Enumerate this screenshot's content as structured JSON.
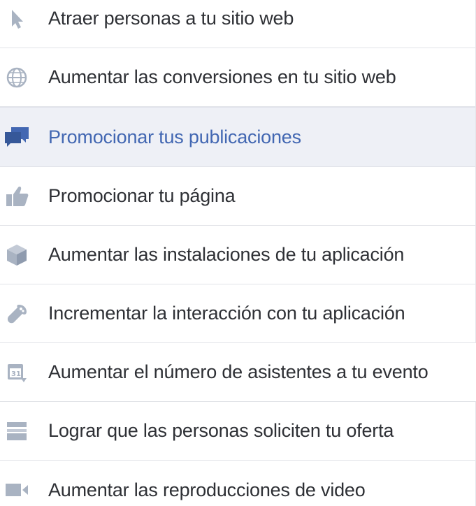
{
  "objectives": {
    "selected_index": 2,
    "selected_color": "#4267b2",
    "icon_color": "#9aa6b8",
    "items": [
      {
        "label": "Atraer personas a tu sitio web",
        "icon": "cursor-icon"
      },
      {
        "label": "Aumentar las conversiones en tu sitio web",
        "icon": "globe-icon"
      },
      {
        "label": "Promocionar tus publicaciones",
        "icon": "chat-bubbles-icon"
      },
      {
        "label": "Promocionar tu página",
        "icon": "thumbs-up-icon"
      },
      {
        "label": "Aumentar las instalaciones de tu aplicación",
        "icon": "cube-icon"
      },
      {
        "label": "Incrementar la interacción con tu aplicación",
        "icon": "gamepad-icon"
      },
      {
        "label": "Aumentar el número de asistentes a tu evento",
        "icon": "calendar-icon"
      },
      {
        "label": "Lograr que las personas soliciten tu oferta",
        "icon": "offer-icon"
      },
      {
        "label": "Aumentar las reproducciones de video",
        "icon": "video-camera-icon"
      }
    ]
  }
}
